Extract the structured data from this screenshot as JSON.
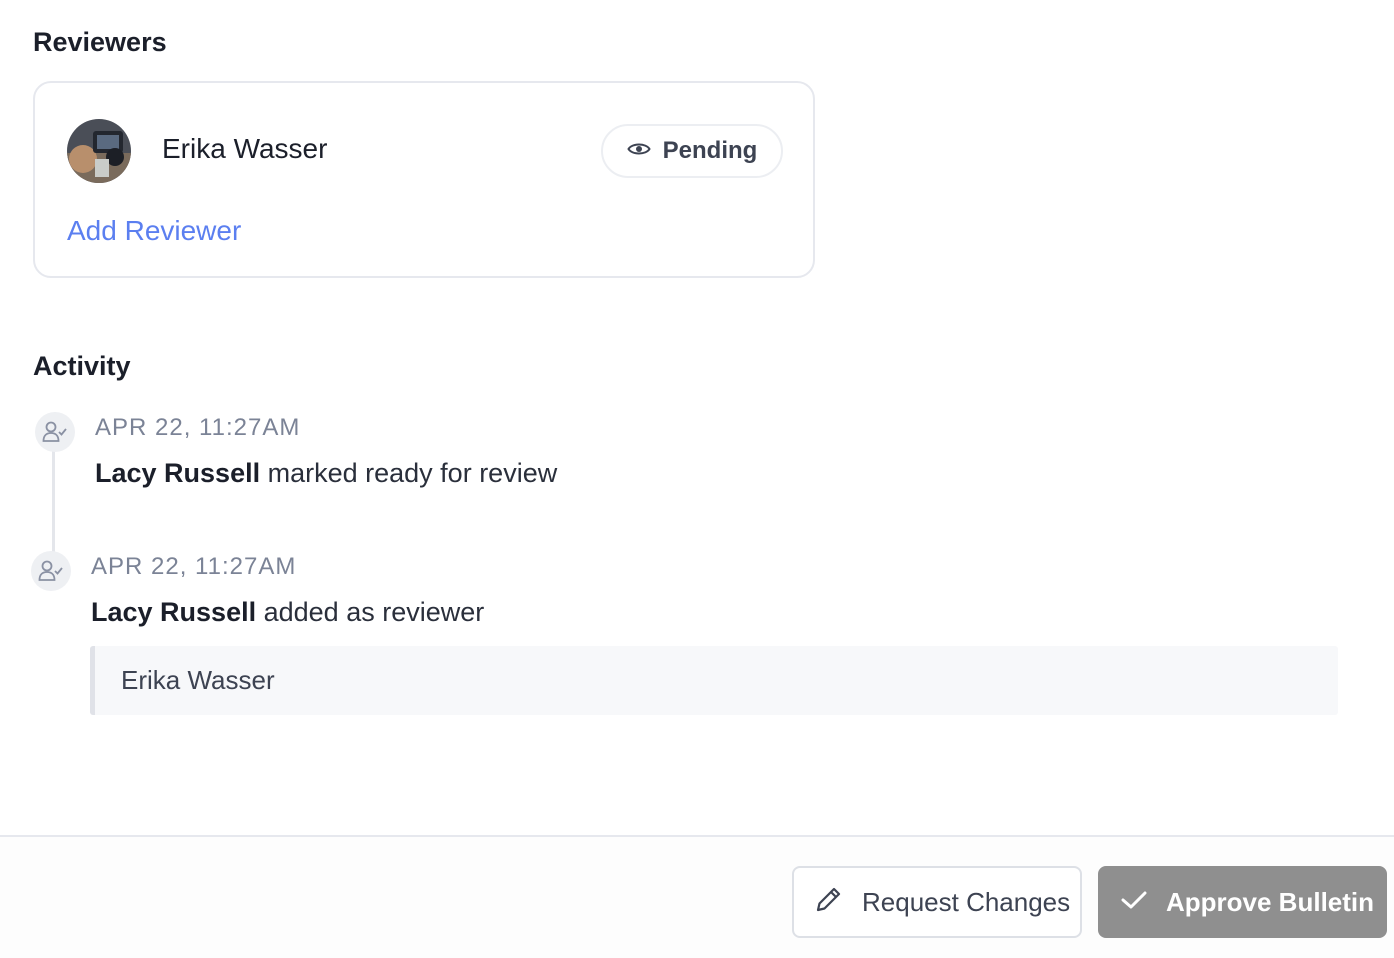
{
  "reviewers": {
    "title": "Reviewers",
    "list": [
      {
        "name": "Erika Wasser",
        "status": "Pending",
        "status_icon": "eye-icon"
      }
    ],
    "add_label": "Add Reviewer"
  },
  "activity": {
    "title": "Activity",
    "items": [
      {
        "time": "APR 22, 11:27AM",
        "actor": "Lacy Russell",
        "action": "marked ready for review",
        "icon": "user-check-icon"
      },
      {
        "time": "APR 22, 11:27AM",
        "actor": "Lacy Russell",
        "action": "added as reviewer",
        "detail": "Erika Wasser",
        "icon": "user-check-icon"
      }
    ]
  },
  "footer": {
    "request_changes_label": "Request Changes",
    "approve_label": "Approve Bulletin"
  },
  "colors": {
    "link": "#5b7ff0",
    "approve_bg": "#8f8f8f",
    "muted_text": "#7b8396"
  }
}
